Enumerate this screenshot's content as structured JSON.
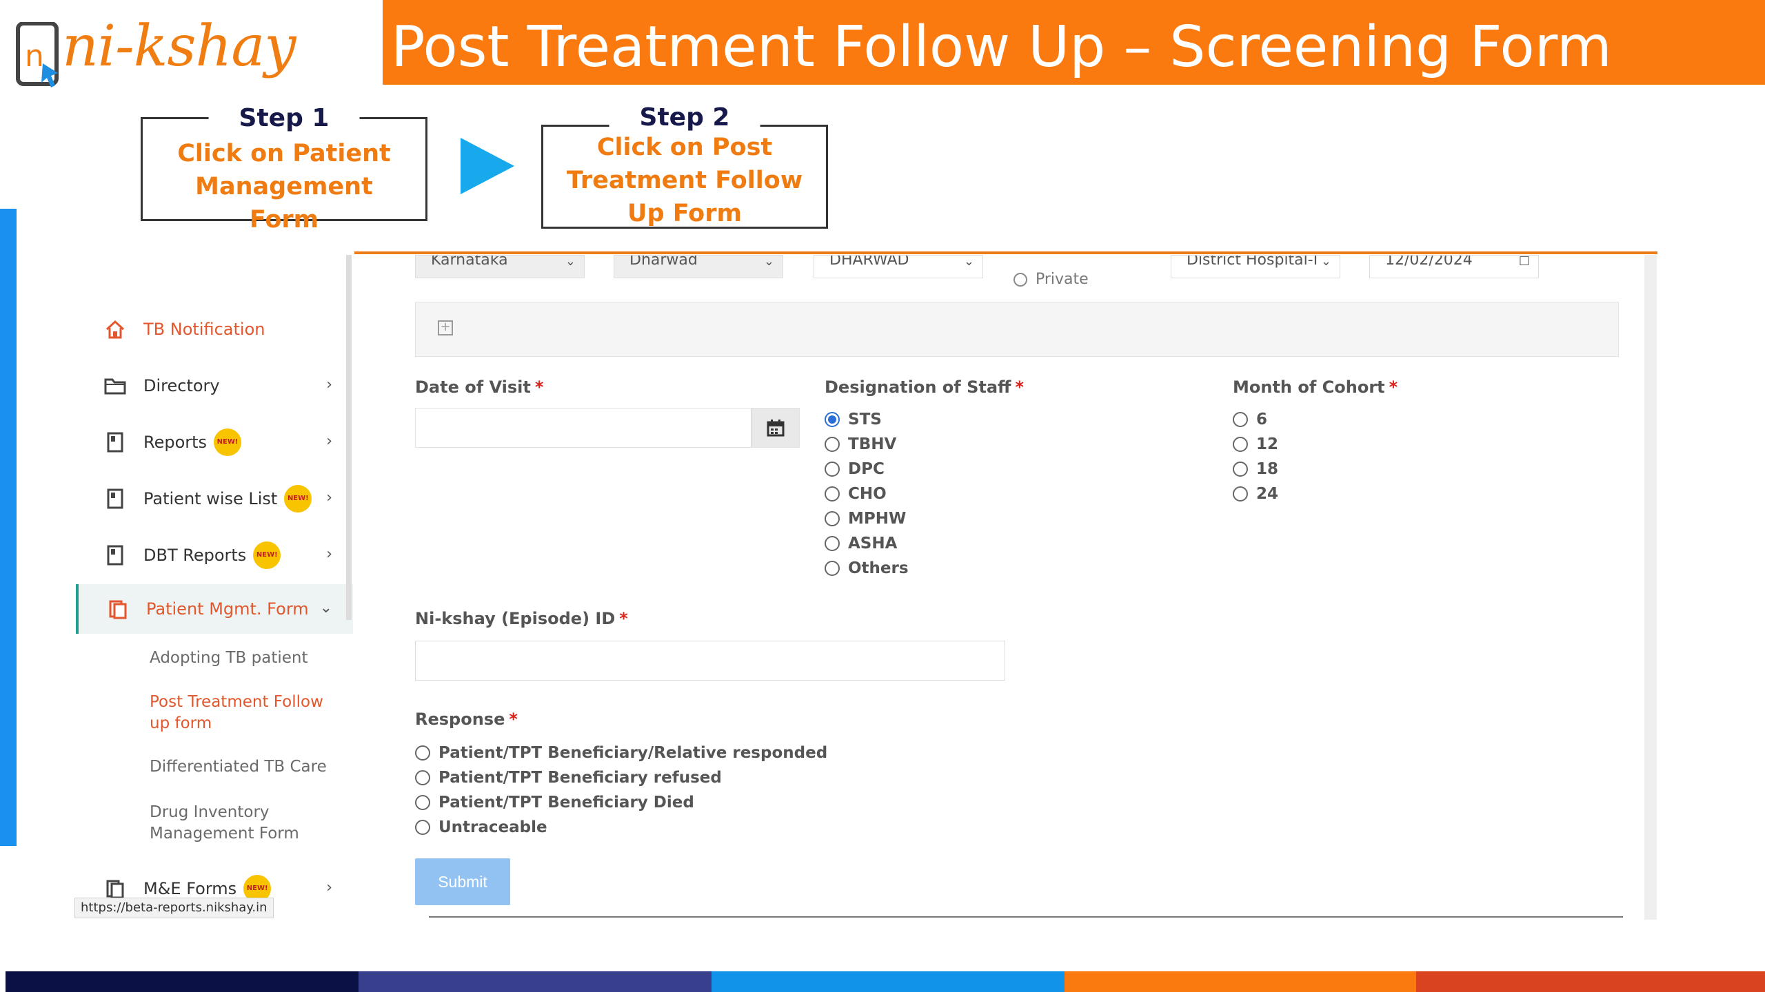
{
  "logo": {
    "text": "ni-kshay"
  },
  "slide": {
    "title": "Post Treatment Follow Up – Screening Form"
  },
  "steps": [
    {
      "title": "Step 1",
      "text": "Click on Patient Management Form"
    },
    {
      "title": "Step 2",
      "text": "Click on Post Treatment Follow Up Form"
    }
  ],
  "sidebar": {
    "items": [
      {
        "label": "TB Notification",
        "icon": "home-icon"
      },
      {
        "label": "Directory",
        "icon": "folder-icon"
      },
      {
        "label": "Reports",
        "icon": "report-icon",
        "badge": "NEW!"
      },
      {
        "label": "Patient wise List",
        "icon": "report-icon",
        "badge": "NEW!"
      },
      {
        "label": "DBT Reports",
        "icon": "report-icon",
        "badge": "NEW!"
      },
      {
        "label": "Patient Mgmt. Form",
        "icon": "clipboard-icon"
      },
      {
        "label": "M&E Forms",
        "icon": "form-icon",
        "badge": "NEW!"
      }
    ],
    "subitems": [
      "Adopting TB patient",
      "Post Treatment Follow up form",
      "Differentiated TB Care",
      "Drug Inventory Management Form"
    ],
    "status_url": "https://beta-reports.nikshay.in"
  },
  "filters": {
    "state": "Karnataka",
    "district": "Dharwad",
    "tu": "DHARWAD",
    "sector_option": "Private",
    "facility": "District Hospital-I",
    "date": "12/02/2024"
  },
  "form": {
    "date_of_visit_label": "Date of Visit",
    "designation_label": "Designation of Staff",
    "designation_options": [
      "STS",
      "TBHV",
      "DPC",
      "CHO",
      "MPHW",
      "ASHA",
      "Others"
    ],
    "designation_selected": "STS",
    "cohort_label": "Month of Cohort",
    "cohort_options": [
      "6",
      "12",
      "18",
      "24"
    ],
    "nikshay_id_label": "Ni-kshay (Episode) ID",
    "response_label": "Response",
    "response_options": [
      "Patient/TPT Beneficiary/Relative responded",
      "Patient/TPT Beneficiary refused",
      "Patient/TPT Beneficiary Died",
      "Untraceable"
    ],
    "required_mark": "*",
    "submit_label": "Submit"
  },
  "colors": {
    "brand_orange": "#fb7a10",
    "accent_blue": "#1991ee",
    "footer": [
      "#0b1045",
      "#383f8c",
      "#1293ea",
      "#fb7a10",
      "#d9431f"
    ]
  }
}
